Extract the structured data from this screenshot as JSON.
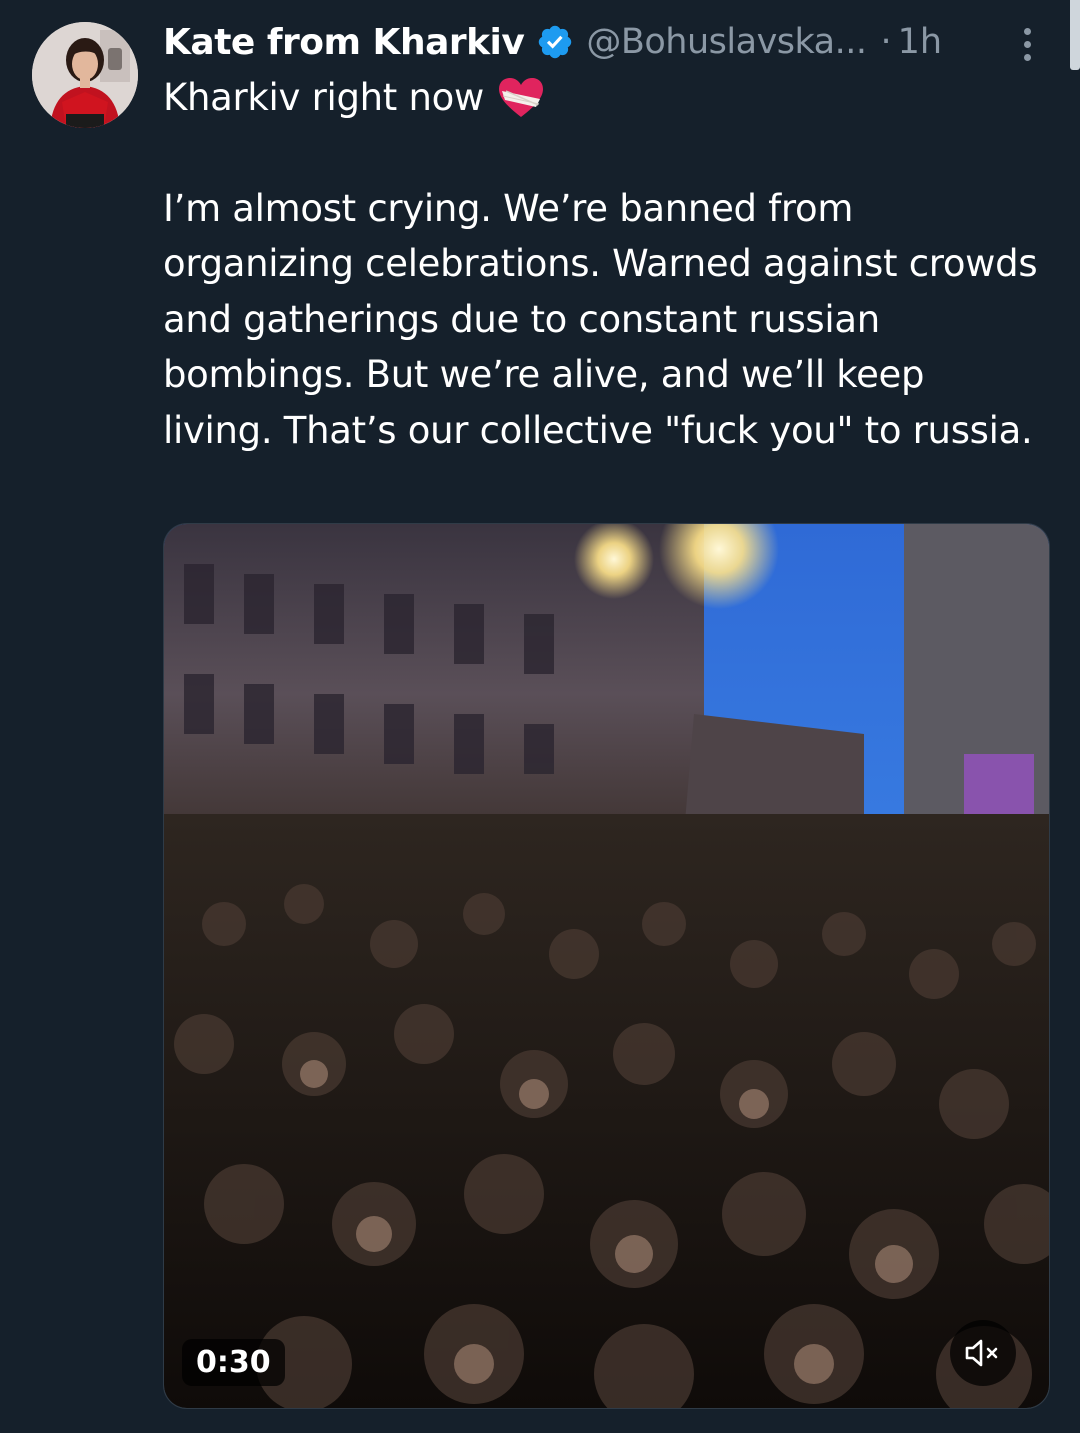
{
  "author": {
    "display_name": "Kate from Kharkiv",
    "handle": "@Bohuslavska...",
    "separator": "·",
    "time_ago": "1h",
    "verified": true,
    "verified_color": "#1d9bf0"
  },
  "tweet": {
    "first_line": "Kharkiv right now",
    "first_line_emoji": "mending-heart-icon",
    "body": "I’m almost crying. We’re banned from organizing celebrations. Warned against crowds and gatherings due to constant russian bombings. But we’re alive, and we’ll keep living. That’s our collective \"fuck you\" to russia."
  },
  "media": {
    "type": "video",
    "duration": "0:30",
    "muted": true
  },
  "theme": {
    "background": "#15202b",
    "secondary_text": "#8b98a5"
  }
}
